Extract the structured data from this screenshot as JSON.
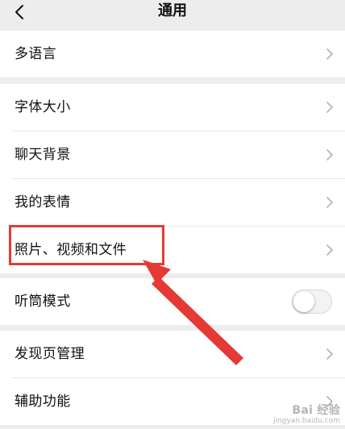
{
  "header": {
    "title": "通用",
    "back_icon": "chevron-left-icon"
  },
  "groups": [
    {
      "items": [
        {
          "label": "多语言",
          "control": "chevron"
        }
      ]
    },
    {
      "items": [
        {
          "label": "字体大小",
          "control": "chevron"
        },
        {
          "label": "聊天背景",
          "control": "chevron"
        },
        {
          "label": "我的表情",
          "control": "chevron"
        },
        {
          "label": "照片、视频和文件",
          "control": "chevron"
        }
      ]
    },
    {
      "items": [
        {
          "label": "听筒模式",
          "control": "toggle",
          "toggle_on": false
        }
      ]
    },
    {
      "items": [
        {
          "label": "发现页管理",
          "control": "chevron"
        },
        {
          "label": "辅助功能",
          "control": "chevron"
        }
      ]
    }
  ],
  "annotation": {
    "highlighted_item": "照片、视频和文件",
    "color": "#e53935"
  },
  "watermark": {
    "text": "Bai 经验",
    "sub": "jingyan.baidu.com"
  }
}
